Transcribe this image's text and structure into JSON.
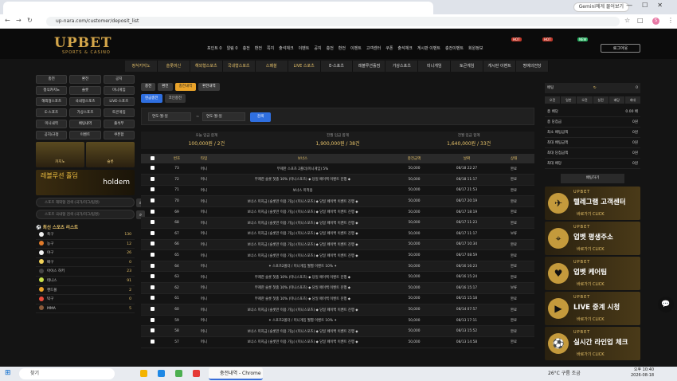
{
  "browser": {
    "url": "up-nara.com/customer/deposit_list",
    "gemini_btn": "Gemini에게 물어보기",
    "profile_initial": "S"
  },
  "site": {
    "logo": "UPBET",
    "logo_sub": "SPORTS & CASINO",
    "top_menu": [
      "포인트 0",
      "알림 0",
      "충전",
      "환전",
      "쪽지",
      "출석체크",
      "이벤트",
      "공지",
      "충전",
      "환전",
      "이벤트",
      "고객센터",
      "쿠폰",
      "출석체크",
      "게시판 이벤트",
      "충전이벤트",
      "회원정보"
    ],
    "hot_labels": [
      "HOT",
      "HOT",
      "NEW"
    ],
    "login_btn": "로그아웃",
    "main_nav": [
      "정식카지노",
      "슬롯머신",
      "해외형스포츠",
      "국내형스포츠",
      "스페셜",
      "LIVE 스포츠",
      "E-스포츠",
      "레볼루션홀덤",
      "가상스포츠",
      "미니게임",
      "토큰게임",
      "게시판 이벤트",
      "명예의전당"
    ]
  },
  "left": {
    "grid": [
      "충전",
      "환전",
      "공지",
      "정식카지노",
      "슬롯",
      "미니게임",
      "해외형스포츠",
      "국내형스포츠",
      "LIVE-스포츠",
      "E-스포츠",
      "가상스포츠",
      "토큰게임",
      "미니내역",
      "배팅내역",
      "출석부",
      "공지/규정",
      "이벤트",
      "쿠폰함"
    ],
    "banner_cards": [
      "카지노",
      "슬롯"
    ],
    "banner2_title": "레볼루션 홀덤",
    "banner2_sub": "holdem",
    "search1": "스포츠 해외형 검색 (국가/리그/팀명)",
    "search2": "스포츠 국내형 검색 (국가/리그/팀명)",
    "sports_title": "최신 스포츠 리스트",
    "sports_title_icon": "ball-icon",
    "sports": [
      {
        "name": "축구",
        "count": "130",
        "color": "#eeeeee"
      },
      {
        "name": "농구",
        "count": "12",
        "color": "#e07a2a"
      },
      {
        "name": "야구",
        "count": "26",
        "color": "#f4f4f4"
      },
      {
        "name": "배구",
        "count": "0",
        "color": "#f2d35a"
      },
      {
        "name": "아이스 하키",
        "count": "23",
        "color": "#444444"
      },
      {
        "name": "테니스",
        "count": "91",
        "color": "#c8e04a"
      },
      {
        "name": "핸드볼",
        "count": "2",
        "color": "#e9a32a"
      },
      {
        "name": "탁구",
        "count": "0",
        "color": "#e84a3a"
      },
      {
        "name": "MMA",
        "count": "5",
        "color": "#8a5a3a"
      }
    ]
  },
  "center": {
    "sub_tabs": [
      "충전",
      "환전",
      "충전내역",
      "환전내역"
    ],
    "deposit_tabs": [
      "현금충전",
      "코인충전"
    ],
    "date_from": "연도-월-일",
    "date_to": "연도-월-일",
    "date_sep": "~",
    "search_btn": "검색",
    "totals": [
      {
        "label": "오늘 입금 합계",
        "value": "100,000원 / 2건"
      },
      {
        "label": "전월 입금 합계",
        "value": "1,900,000원 / 38건"
      },
      {
        "label": "전월 입금 합계",
        "value": "1,640,000원 / 33건"
      }
    ],
    "headers": [
      "",
      "번호",
      "타입",
      "보너스",
      "충전금액",
      "날짜",
      "상태"
    ],
    "rows": [
      [
        "73",
        "머니",
        "무제한 스포츠 2폴더(미니게임) 5%",
        "50,000",
        "08/18 22:27",
        "완료"
      ],
      [
        "72",
        "머니",
        "무제한 슬롯 첫충 10% (미니스포츠) ◆ 당일 페이백 이벤트 진행 ◆",
        "50,000",
        "08/18 11:17",
        "완료"
      ],
      [
        "71",
        "머니",
        "보너스 미적용",
        "50,000",
        "08/17 21:53",
        "완료"
      ],
      [
        "70",
        "머니",
        "보너스 미지급 (슬롯만 이용 가능) (미니스포츠) ◆ 당일 페이백 이벤트 진행 ◆",
        "50,000",
        "08/17 20:19",
        "완료"
      ],
      [
        "69",
        "머니",
        "보너스 미지급 (슬롯만 이용 가능) (미니스포츠) ◆ 당일 페이백 이벤트 진행 ◆",
        "50,000",
        "08/17 18:19",
        "완료"
      ],
      [
        "68",
        "머니",
        "보너스 미지급 (슬롯만 이용 가능) (미니스포츠) ◆ 당일 페이백 이벤트 진행 ◆",
        "50,000",
        "08/17 11:23",
        "완료"
      ],
      [
        "67",
        "머니",
        "보너스 미지급 (슬롯만 이용 가능) (미니스포츠) ◆ 당일 페이백 이벤트 진행 ◆",
        "50,000",
        "08/17 11:17",
        "보류"
      ],
      [
        "66",
        "머니",
        "보너스 미지급 (슬롯만 이용 가능) (미니스포츠) ◆ 당일 페이백 이벤트 진행 ◆",
        "50,000",
        "08/17 10:34",
        "완료"
      ],
      [
        "65",
        "머니",
        "보너스 미지급 (슬롯만 이용 가능) (미니스포츠) ◆ 당일 페이백 이벤트 진행 ◆",
        "50,000",
        "08/17 08:59",
        "완료"
      ],
      [
        "64",
        "머니",
        "✦ 스포츠2폴더 / 미니게임 월별 이벤트 10% ✦",
        "50,000",
        "08/16 16:23",
        "완료"
      ],
      [
        "63",
        "머니",
        "무제한 슬롯 첫충 10% (미니스포츠) ◆ 당일 페이백 이벤트 진행 ◆",
        "50,000",
        "08/16 15:24",
        "완료"
      ],
      [
        "62",
        "머니",
        "무제한 슬롯 첫충 10% (미니스포츠) ◆ 당일 페이백 이벤트 진행 ◆",
        "50,000",
        "08/16 15:17",
        "보류"
      ],
      [
        "61",
        "머니",
        "무제한 슬롯 첫충 10% (미니스포츠) ◆ 당일 페이백 이벤트 진행 ◆",
        "50,000",
        "08/15 15:18",
        "완료"
      ],
      [
        "60",
        "머니",
        "보너스 미지급 (슬롯만 이용 가능) (미니스포츠) ◆ 당일 페이백 이벤트 진행 ◆",
        "50,000",
        "08/14 07:57",
        "완료"
      ],
      [
        "59",
        "머니",
        "✦ 스포츠2폴더 / 미니게임 월별 이벤트 10% ✦",
        "50,000",
        "08/13 17:11",
        "완료"
      ],
      [
        "58",
        "머니",
        "보너스 미지급 (슬롯만 이용 가능) (미니스포츠) ◆ 당일 페이백 이벤트 진행 ◆",
        "50,000",
        "08/13 15:52",
        "완료"
      ],
      [
        "57",
        "머니",
        "보너스 미지급 (슬롯만 이용 가능) (미니스포츠) ◆ 당일 페이백 이벤트 진행 ◆",
        "50,000",
        "08/13 14:58",
        "완료"
      ]
    ]
  },
  "right": {
    "bet_label": "배팅",
    "bet_value": "0",
    "period_tabs": [
      "오전",
      "일반",
      "오전",
      "실전",
      "배당",
      "최대"
    ],
    "rows": [
      {
        "label": "총 배당",
        "value": "0.00 배"
      },
      {
        "label": "총 당첨금",
        "value": "0원"
      },
      {
        "label": "최소 배팅금액",
        "value": "0원"
      },
      {
        "label": "최대 배팅금액",
        "value": "0원"
      },
      {
        "label": "최대 당첨금액",
        "value": "0원"
      },
      {
        "label": "최대 배당",
        "value": "0원"
      }
    ],
    "bet_btn": "배팅하기",
    "banners": [
      {
        "brand": "UPBET",
        "title": "텔레그램 고객센터",
        "cta": "바로가기 CLICK",
        "icon": "✈"
      },
      {
        "brand": "UPBET",
        "title": "업벳 평생주소",
        "cta": "바로가기 CLICK",
        "icon": "⌖"
      },
      {
        "brand": "UPBET",
        "title": "업벳 케어팀",
        "cta": "바로가기 CLICK",
        "icon": "♥"
      },
      {
        "brand": "UPBET",
        "title": "LIVE 중계 시청",
        "cta": "바로가기 CLICK",
        "icon": "▶"
      },
      {
        "brand": "UPBET",
        "title": "실시간 라인업 체크",
        "cta": "바로가기 CLICK",
        "icon": "⚽"
      }
    ]
  },
  "taskbar": {
    "search": "찾기",
    "app": "충전내역 - Chrome",
    "weather": "26°C 구름 조금",
    "time": "오후 10:40",
    "date": "2026-08-18"
  }
}
